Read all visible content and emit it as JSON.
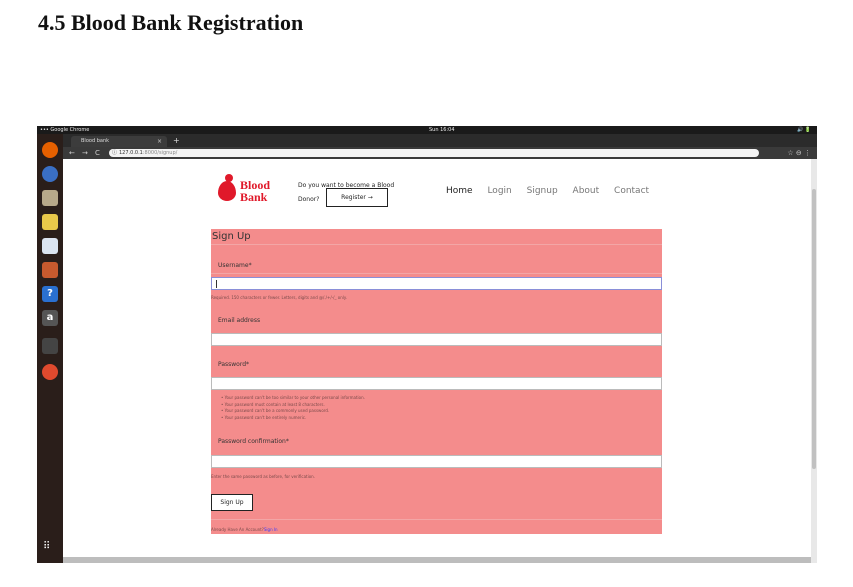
{
  "document": {
    "heading": "4.5 Blood Bank Registration"
  },
  "os": {
    "activities_label": "••• Google Chrome",
    "clock": "Sun 16:04",
    "tray": "🔊 🔋",
    "app_grid_icon": "⠿"
  },
  "dock": [
    {
      "name": "firefox-icon",
      "glyph": "",
      "color": "#e66000"
    },
    {
      "name": "thunderbird-icon",
      "glyph": "",
      "color": "#3a6fc4"
    },
    {
      "name": "files-icon",
      "glyph": "",
      "color": "#b8a98a"
    },
    {
      "name": "rhythmbox-icon",
      "glyph": "",
      "color": "#e8c84a"
    },
    {
      "name": "writer-icon",
      "glyph": "",
      "color": "#dbe4f0"
    },
    {
      "name": "software-center-icon",
      "glyph": "",
      "color": "#c85a2e"
    },
    {
      "name": "help-icon",
      "glyph": "?",
      "color": "#2a70d0"
    },
    {
      "name": "amazon-icon",
      "glyph": "a",
      "color": "#555555"
    },
    {
      "name": "terminal-icon",
      "glyph": "",
      "color": "#444444"
    },
    {
      "name": "chrome-icon",
      "glyph": "",
      "color": "#e04a2e"
    }
  ],
  "browser": {
    "tab_title": "Blood bank",
    "tab_close": "×",
    "new_tab": "+",
    "back": "←",
    "forward": "→",
    "reload": "C",
    "url_host": "127.0.0.1",
    "url_path": ":8000/signup/",
    "info_icon": "ⓘ",
    "right_icons": "☆ ⊖ ⋮"
  },
  "site": {
    "logo_text_1": "Blood",
    "logo_text_2": "Bank",
    "cta_text": "Do you want to become a Blood Donor?",
    "register_button": "Register →",
    "nav": [
      "Home",
      "Login",
      "Signup",
      "About",
      "Contact"
    ]
  },
  "form": {
    "title": "Sign Up",
    "username_label": "Username*",
    "username_help": "Required. 150 characters or fewer. Letters, digits and @/./+/-/_ only.",
    "email_label": "Email address",
    "password_label": "Password*",
    "password_rules": [
      "Your password can't be too similar to your other personal information.",
      "Your password must contain at least 8 characters.",
      "Your password can't be a commonly used password.",
      "Your password can't be entirely numeric."
    ],
    "confirm_label": "Password confirmation*",
    "confirm_help": "Enter the same password as before, for verification.",
    "signup_button": "Sign Up",
    "already_text": "Already Have An Account?",
    "signin_link": "Sign In"
  }
}
